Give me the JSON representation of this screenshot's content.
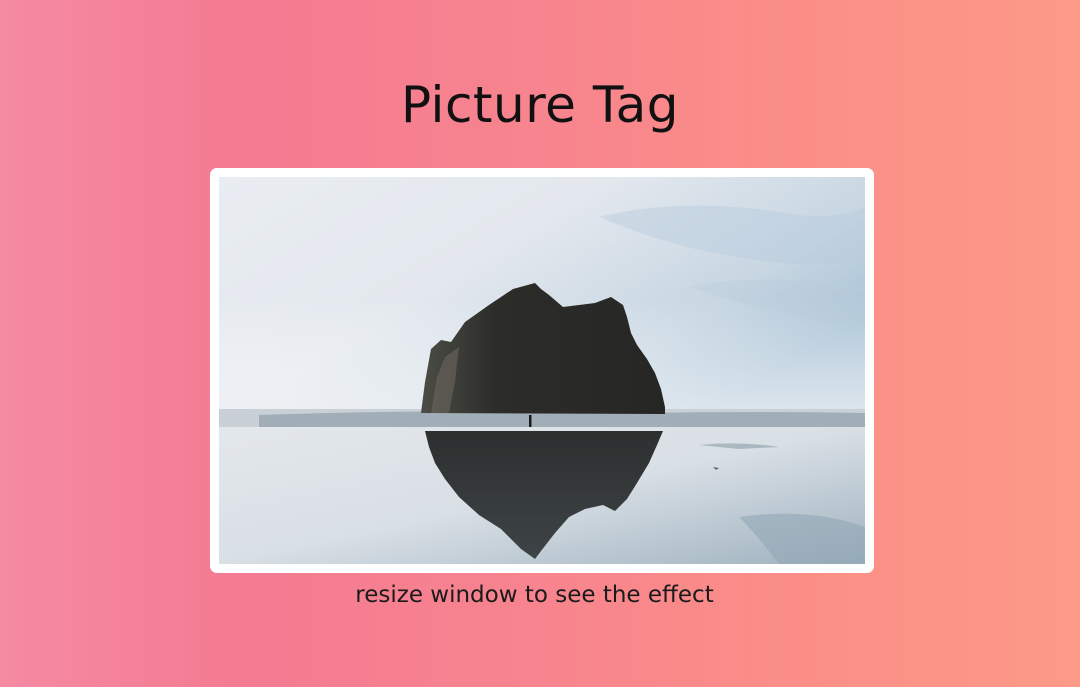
{
  "page": {
    "title": "Picture Tag",
    "caption": "resize window to see the effect"
  },
  "image": {
    "subject": "rock-island-beach-reflection-photo"
  },
  "colors": {
    "gradient_left": "#f58aa3",
    "gradient_mid": "#f7848e",
    "gradient_right": "#fd9a88",
    "frame": "#ffffff",
    "text": "#111111"
  }
}
